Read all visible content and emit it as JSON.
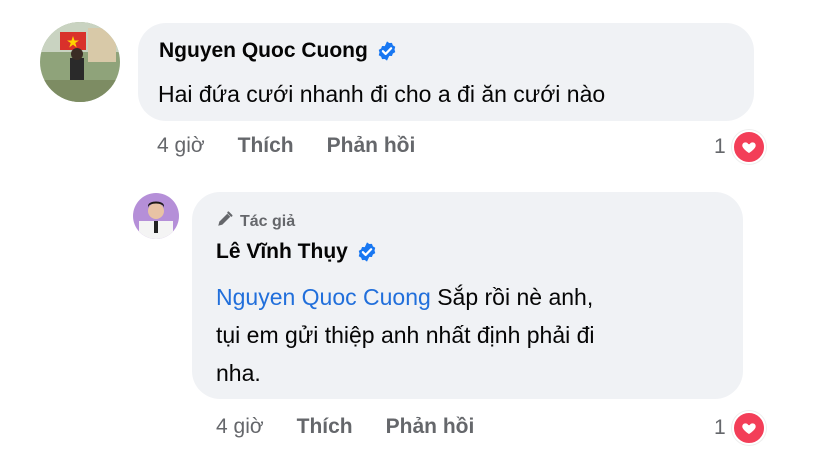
{
  "comment": {
    "author_name": "Nguyen Quoc Cuong",
    "text": "Hai đứa cưới nhanh đi cho a đi ăn cưới nào",
    "time": "4 giờ",
    "like_label": "Thích",
    "reply_label": "Phản hồi",
    "reaction_count": "1"
  },
  "reply": {
    "author_badge": "Tác giả",
    "author_name": "Lê Vĩnh Thụy",
    "mention": "Nguyen Quoc Cuong",
    "text_line1": " Sắp rồi nè anh,",
    "text_line2": "tụi em gửi thiệp anh nhất định phải đi",
    "text_line3": "nha.",
    "time": "4 giờ",
    "like_label": "Thích",
    "reply_label": "Phản hồi",
    "reaction_count": "1"
  },
  "colors": {
    "bubble": "#f0f2f5",
    "verified": "#1877f2",
    "heart": "#f33e58",
    "mention": "#216fdb",
    "meta_text": "#65676b"
  },
  "icons": {
    "verified": "verified-badge-icon",
    "heart": "heart-reaction-icon",
    "author": "pen-icon"
  }
}
